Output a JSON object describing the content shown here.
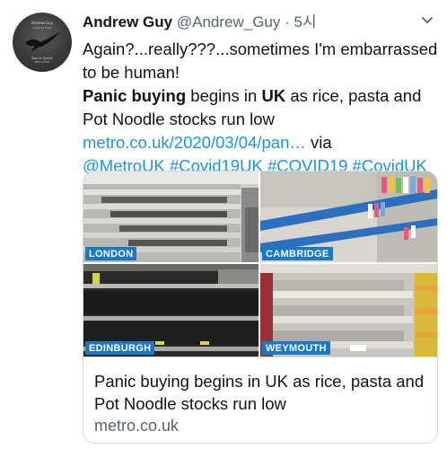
{
  "tweet": {
    "author_name": "Andrew Guy",
    "handle": "@Andrew_Guy",
    "separator": "·",
    "time": "5시",
    "line1": "Again?...really???...sometimes I'm embarrassed to be human!",
    "line2_bold1": "Panic buying",
    "line2_text1": " begins in ",
    "line2_bold2": "UK",
    "line2_text2": " as rice, pasta and Pot Noodle stocks run low",
    "link_url": "metro.co.uk/2020/03/04/pan…",
    "via_text": " via",
    "mention": "@MetroUK",
    "hashtags": [
      "#Covid19UK",
      "#COVID19",
      "#CovidUK"
    ]
  },
  "avatar": {
    "icon": "bird-silhouette",
    "lettering": "Andrew Guy",
    "lettering_bottom": "Real or Spoofy"
  },
  "card": {
    "images": [
      {
        "label": "LONDON"
      },
      {
        "label": "CAMBRIDGE"
      },
      {
        "label": "EDINBURGH"
      },
      {
        "label": "WEYMOUTH"
      }
    ],
    "title": "Panic buying begins in UK as rice, pasta and Pot Noodle stocks run low",
    "domain": "metro.co.uk"
  },
  "colors": {
    "link": "#1b95e0",
    "label_bg": "#1b78c6",
    "muted": "#536471"
  }
}
